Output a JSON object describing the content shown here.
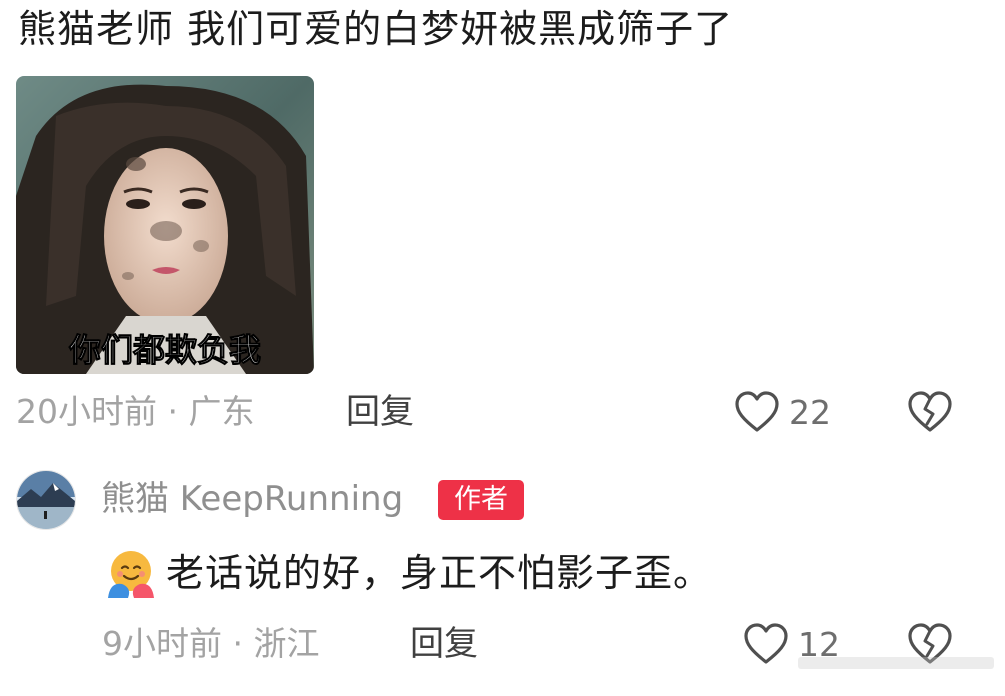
{
  "top_comment": {
    "text": "熊猫老师 我们可爱的白梦妍被黑成筛子了",
    "image_caption": "你们都欺负我",
    "time_location": "20小时前 · 广东",
    "reply_label": "回复",
    "like_count": "22",
    "icons": {
      "like": "heart-outline-icon",
      "dislike": "broken-heart-icon"
    }
  },
  "reply": {
    "username": "熊猫 KeepRunning",
    "author_badge": "作者",
    "emoji": "hugging-face-emoji",
    "text": "老话说的好，身正不怕影子歪。",
    "time_location": "9小时前 · 浙江",
    "reply_label": "回复",
    "like_count": "12"
  },
  "colors": {
    "text_primary": "#1c1c1c",
    "text_meta": "#a3a3a3",
    "username": "#8f8f8f",
    "badge_bg": "#ee3147",
    "icon": "#505050"
  }
}
